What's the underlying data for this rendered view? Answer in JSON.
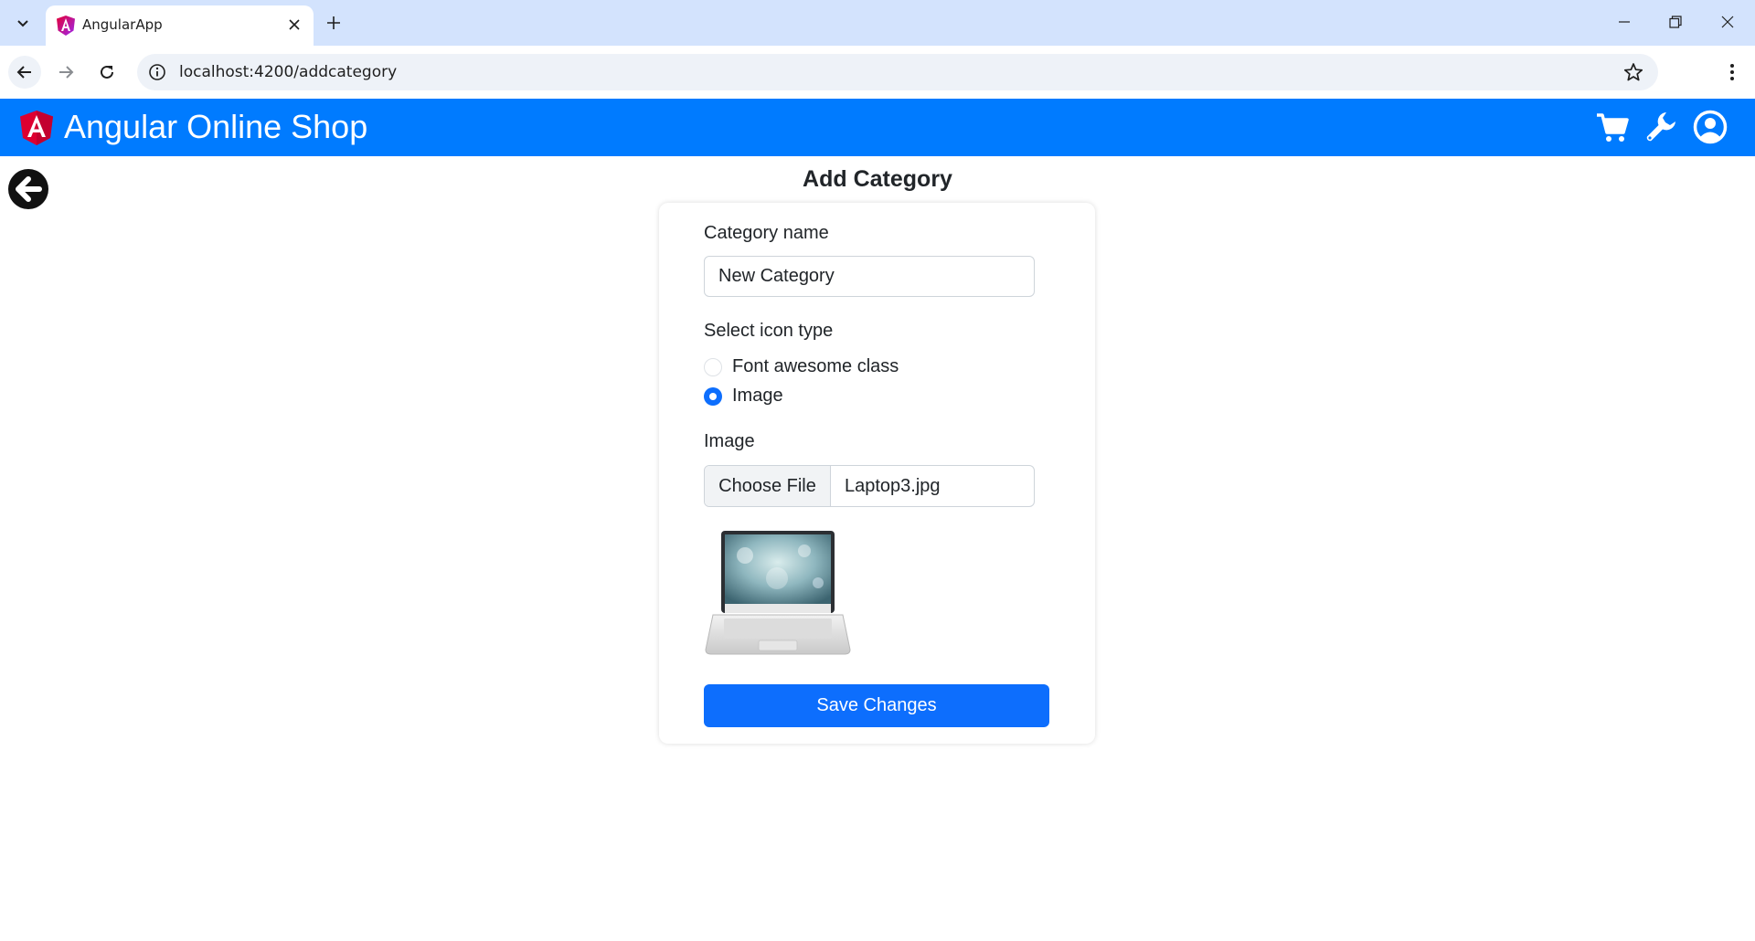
{
  "browser": {
    "tab_title": "AngularApp",
    "url": "localhost:4200/addcategory"
  },
  "navbar": {
    "brand": "Angular Online Shop",
    "icons": [
      "cart-icon",
      "wrench-icon",
      "user-circle-icon"
    ],
    "color": "#007bff"
  },
  "page": {
    "title": "Add Category"
  },
  "form": {
    "category_name_label": "Category name",
    "category_name_value": "New Category",
    "icon_type_label": "Select icon type",
    "icon_type_options": [
      {
        "label": "Font awesome class",
        "checked": false
      },
      {
        "label": "Image",
        "checked": true
      }
    ],
    "image_label": "Image",
    "file_button": "Choose File",
    "file_name": "Laptop3.jpg",
    "save_label": "Save Changes",
    "accent": "#0d6efd"
  }
}
